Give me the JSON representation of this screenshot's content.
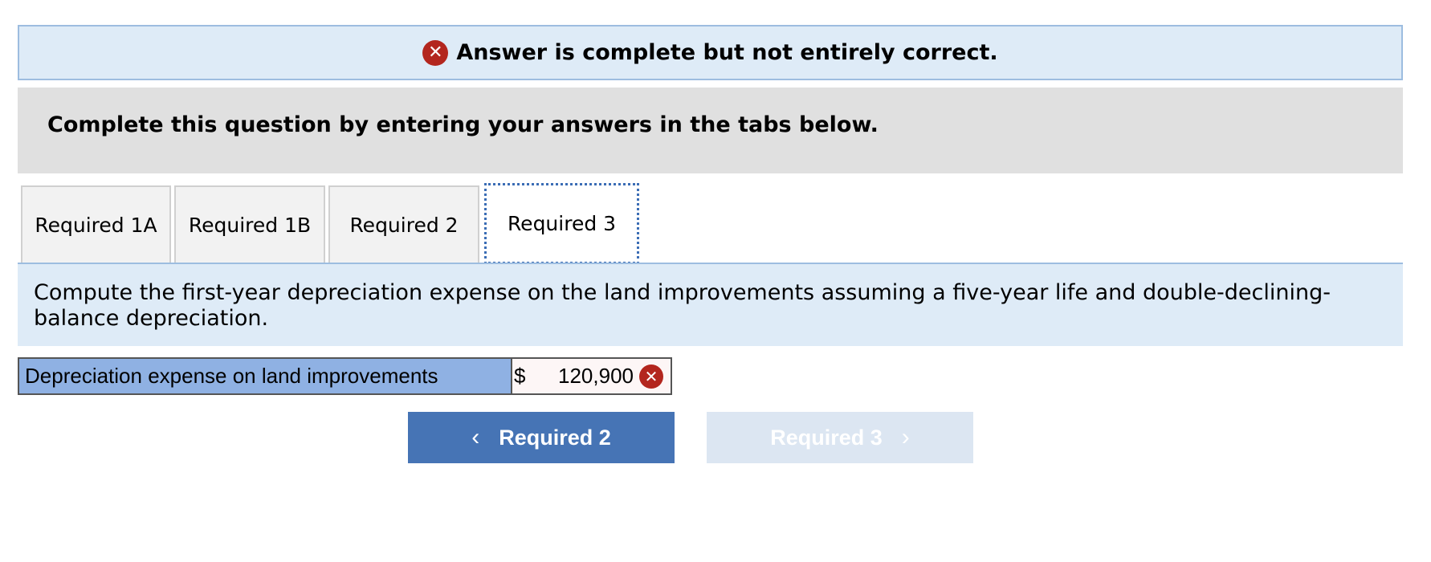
{
  "banner": {
    "icon": "x-circle-icon",
    "icon_glyph": "✕",
    "text": "Answer is complete but not entirely correct."
  },
  "instruction": {
    "text": "Complete this question by entering your answers in the tabs below."
  },
  "tabs": [
    {
      "label": "Required 1A",
      "active": false
    },
    {
      "label": "Required 1B",
      "active": false
    },
    {
      "label": "Required 2",
      "active": false
    },
    {
      "label": "Required 3",
      "active": true
    }
  ],
  "question": {
    "line1": "Compute the first-year depreciation expense on the land improvements assuming a five-year life and double-declining-",
    "line2": "balance depreciation."
  },
  "answer": {
    "label": "Depreciation expense on land improvements",
    "currency": "$",
    "value": "120,900",
    "status": "incorrect",
    "icon": "x-circle-icon",
    "icon_glyph": "✕"
  },
  "nav": {
    "prev_label": "Required 2",
    "prev_chevron": "‹",
    "next_label": "Required 3",
    "next_chevron": "›",
    "next_enabled": false
  },
  "colors": {
    "banner_bg": "#deebf7",
    "error_red": "#b3261e",
    "label_blue": "#8fb1e3",
    "primary_button": "#4674b5",
    "disabled_button": "#dce6f2"
  }
}
